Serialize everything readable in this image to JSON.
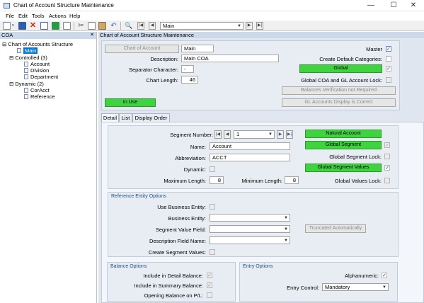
{
  "window": {
    "title": "Chart of Account Structure Maintenance",
    "controls": {
      "minimize": "—",
      "maximize": "☐",
      "close": "✕"
    }
  },
  "menu": [
    "File",
    "Edit",
    "Tools",
    "Actions",
    "Help"
  ],
  "toolbar": {
    "combo_value": "Main"
  },
  "left_panel": {
    "header": "COA",
    "tree": {
      "root": "Chart of Accounts Structure",
      "main": "Main",
      "controlled": "Controlled (3)",
      "controlled_items": [
        "Account",
        "Division",
        "Department"
      ],
      "dynamic": "Dynamic (2)",
      "dynamic_items": [
        "CorAcct",
        "Reference"
      ]
    }
  },
  "right_panel": {
    "header": "Chart of Account Structure Maintenance",
    "top": {
      "chart_of_account_btn": "Chart of Account",
      "coa_name": "Main",
      "master_label": "Master",
      "master_checked": "✓",
      "description_label": "Description:",
      "description_value": "Main COA",
      "create_default_label": "Create Default Categories:",
      "separator_label": "Separator Character:",
      "separator_value": "-",
      "global_btn": "Global",
      "global_checked": "✓",
      "chart_length_label": "Chart Length:",
      "chart_length_value": "46",
      "global_coa_lock_label": "Global COA and GL Account Lock:",
      "balances_btn": "Balances Verification not Required",
      "in_use_btn": "In Use",
      "gl_display_btn": "GL Accounts Display is Correct"
    },
    "tabs": [
      "Detail",
      "List",
      "Display Order"
    ],
    "detail": {
      "segment_number_label": "Segment Number:",
      "segment_number_value": "1",
      "natural_account_btn": "Natural Account",
      "global_segment_btn": "Global Segment",
      "global_segment_checked": "✓",
      "name_label": "Name:",
      "name_value": "Account",
      "global_segment_lock_label": "Global Segment Lock:",
      "abbreviation_label": "Abbreviation:",
      "abbreviation_value": "ACCT",
      "global_segment_values_btn": "Global Segment Values",
      "global_segment_values_checked": "✓",
      "dynamic_label": "Dynamic:",
      "max_length_label": "Maximum Length:",
      "max_length_value": "8",
      "min_length_label": "Minimum Length:",
      "min_length_value": "8",
      "global_values_lock_label": "Global Values Lock:"
    },
    "reference": {
      "title": "Reference Entity Options",
      "use_business_entity_label": "Use Business Entity:",
      "business_entity_label": "Business Entity:",
      "segment_value_field_label": "Segment Value Field:",
      "truncated_btn": "Truncated Automatically",
      "description_field_label": "Description Field Name:",
      "create_segment_values_label": "Create Segment Values:"
    },
    "balance": {
      "title": "Balance Options",
      "include_detail_label": "Include in Detail Balance:",
      "include_detail_checked": "✓",
      "include_summary_label": "Include in Summary Balance:",
      "include_summary_checked": "✓",
      "opening_balance_label": "Opening Balance on P/L:"
    },
    "entry": {
      "title": "Entry Options",
      "alphanumeric_label": "Alphanumeric:",
      "alphanumeric_checked": "✓",
      "entry_control_label": "Entry Control:",
      "entry_control_value": "Mandatory"
    }
  }
}
